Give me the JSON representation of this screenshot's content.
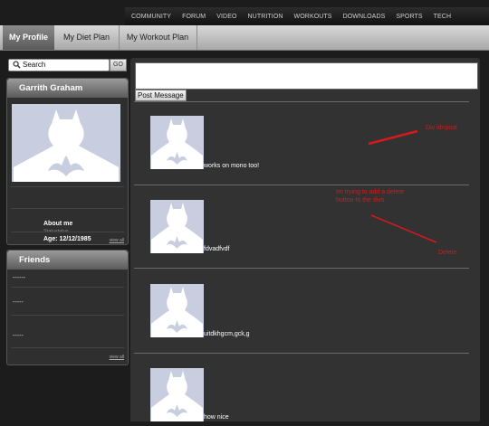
{
  "topnav": [
    "COMMUNITY",
    "FORUM",
    "VIDEO",
    "NUTRITION",
    "WORKOUTS",
    "DOWNLOADS",
    "SPORTS",
    "TECH"
  ],
  "tabs": {
    "profile": "My Profile",
    "diet": "My Diet Plan",
    "workout": "My Workout Plan"
  },
  "search": {
    "placeholder": "Search",
    "go": "GO"
  },
  "profile": {
    "name": "Garrith Graham",
    "about_label": "About me",
    "status": "Statustatus",
    "age": "Age: 12/12/1985",
    "view_all": "view all"
  },
  "friends": {
    "title": "Friends",
    "items": [
      "------",
      "-----",
      "-----"
    ],
    "view_all": "view all"
  },
  "composer": {
    "post_label": "Post Message"
  },
  "posts": [
    {
      "text": "works on mono too!"
    },
    {
      "text": "fdvadfvdf"
    },
    {
      "text": "uitdkhgcm,gck,g"
    },
    {
      "text": "how nice"
    }
  ],
  "annotations": {
    "div": "Div id=post",
    "note": "Im trying to add a delete button to the divs",
    "delete": "Delete"
  },
  "colors": {
    "annotation": "#d41a1a",
    "avatar_bg": "#c8cde0"
  }
}
